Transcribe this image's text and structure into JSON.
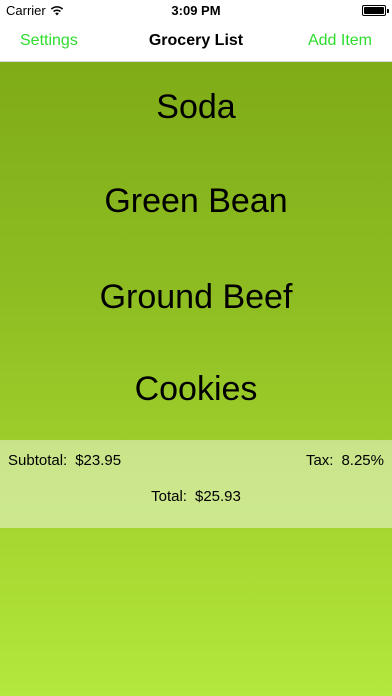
{
  "status_bar": {
    "carrier": "Carrier",
    "time": "3:09 PM"
  },
  "nav": {
    "left_label": "Settings",
    "title": "Grocery List",
    "right_label": "Add Item"
  },
  "items": [
    {
      "label": "Soda"
    },
    {
      "label": "Green Bean"
    },
    {
      "label": "Ground Beef"
    },
    {
      "label": "Cookies"
    }
  ],
  "summary": {
    "subtotal_label": "Subtotal:",
    "subtotal_value": "$23.95",
    "tax_label": "Tax:",
    "tax_value": "8.25%",
    "total_label": "Total:",
    "total_value": "$25.93"
  },
  "colors": {
    "accent": "#2edd2e",
    "background_top": "#7fac17",
    "background_bottom": "#b3e83c"
  },
  "icons": [
    "wifi-icon",
    "battery-icon"
  ]
}
